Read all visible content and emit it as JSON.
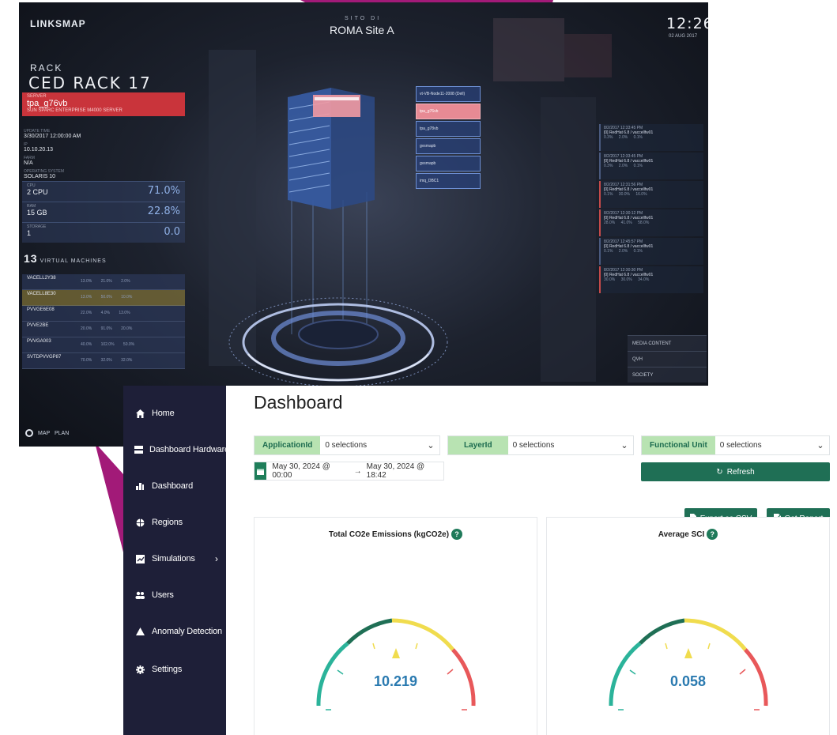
{
  "linksmap": {
    "logo": "LINKSMAP",
    "site_label": "SITO DI",
    "site_name": "ROMA Site A",
    "clock": "12:26",
    "date": "02 AUG 2017",
    "rack_label": "RACK",
    "rack_name": "CED RACK 17",
    "server": {
      "label": "SERVER",
      "name": "tpa_g76vb",
      "subtitle": "SUN SPARC ENTERPRISE M4000 SERVER"
    },
    "info": [
      {
        "key": "UPDATE TIME",
        "value": "3/30/2017 12:00:00 AM"
      },
      {
        "key": "IP",
        "value": "10.10.20.13"
      },
      {
        "key": "FARM",
        "value": "N/A"
      },
      {
        "key": "OPERATING SYSTEM",
        "value": "SOLARIS 10"
      }
    ],
    "metrics": [
      {
        "key": "CPU",
        "value": "2 CPU",
        "percent": "71.0%"
      },
      {
        "key": "RAM",
        "value": "15 GB",
        "percent": "22.8%"
      },
      {
        "key": "STORAGE",
        "value": "1",
        "percent": "0.0"
      }
    ],
    "vm_count": "13",
    "vm_title": "VIRTUAL MACHINES",
    "vms": [
      {
        "name": "VACELL2Y38",
        "metrics": "13.0% 21.0% 2.0%"
      },
      {
        "name": "VACELL8E30",
        "metrics": "13.0% 50.0% 10.0%"
      },
      {
        "name": "PVVGE6E08",
        "metrics": "22.0% 4.0% 13.0%"
      },
      {
        "name": "PVVE2BE",
        "metrics": "20.0% 91.0% 20.0%"
      },
      {
        "name": "PVVGA003",
        "metrics": "40.0% 102.0% 50.0%"
      },
      {
        "name": "SVTDPVVGP87",
        "metrics": "70.0% 32.0% 32.0%"
      }
    ],
    "rack_labels": [
      "vt-VB-Node11-2008 (Dell)",
      "tpa_g76vb",
      "tpa_g78vb",
      "gvsmapb",
      "gvsmapb",
      "imq_DBC1"
    ],
    "logs": [
      {
        "time": "8/2/2017 12:33:45 PM",
        "desc": "[0] RedHat 6.8 / vaccellfw01",
        "metrics": "0.3% 2.0% 0.1%",
        "red": false
      },
      {
        "time": "8/2/2017 12:33:45 PM",
        "desc": "[0] RedHat 6.8 / vaccellfw01",
        "metrics": "0.3% 2.0% 0.1%",
        "red": false
      },
      {
        "time": "8/2/2017 12:31:56 PM",
        "desc": "[0] RedHat 6.8 / vaccellfw01",
        "metrics": "0.1% 30.0% 16.0%",
        "red": true
      },
      {
        "time": "8/2/2017 12:30:12 PM",
        "desc": "[0] RedHat 6.8 / vaccellfw01",
        "metrics": "28.0% 41.0% 58.0%",
        "red": true
      },
      {
        "time": "8/2/2017 12:45:57 PM",
        "desc": "[0] RedHat 6.8 / vaccellfw01",
        "metrics": "0.1% 2.0% 0.1%",
        "red": false
      },
      {
        "time": "8/2/2017 12:30:30 PM",
        "desc": "[0] RedHat 6.8 / vaccellfw01",
        "metrics": "30.0% 30.0% 34.0%",
        "red": true
      }
    ],
    "media": [
      "MEDIA CONTENT",
      "QVH",
      "SOCIETY"
    ],
    "nav": "MAP  PLAN"
  },
  "sidebar": {
    "items": [
      {
        "label": "Home",
        "icon": "home-icon"
      },
      {
        "label": "Dashboard Hardware",
        "icon": "server-icon"
      },
      {
        "label": "Dashboard",
        "icon": "bar-chart-icon"
      },
      {
        "label": "Regions",
        "icon": "globe-icon"
      },
      {
        "label": "Simulations",
        "icon": "chart-icon"
      },
      {
        "label": "Users",
        "icon": "users-icon"
      },
      {
        "label": "Anomaly Detection",
        "icon": "warning-icon"
      },
      {
        "label": "Settings",
        "icon": "gear-icon"
      }
    ],
    "chevron": "›"
  },
  "dashboard": {
    "title": "Dashboard",
    "filters": [
      {
        "label": "ApplicationId",
        "value": "0 selections"
      },
      {
        "label": "LayerId",
        "value": "0 selections"
      },
      {
        "label": "Functional Unit",
        "value": "0 selections"
      }
    ],
    "date_from": "May 30, 2024 @ 00:00",
    "arrow": "→",
    "date_to": "May 30, 2024 @ 18:42",
    "refresh": "Refresh",
    "export_csv": "Export as CSV",
    "get_report": "Get Report",
    "cards": [
      {
        "title": "Total CO2e Emissions (kgCO2e)",
        "value": "10.219",
        "help": "?"
      },
      {
        "title": "Average SCI",
        "value": "0.058",
        "help": "?"
      }
    ]
  },
  "colors": {
    "sidebar_bg": "#1e1f38",
    "accent_green": "#1f6f55",
    "filter_label_bg": "#b8e3b2",
    "gauge_teal": "#2bb39a",
    "gauge_yellow": "#f0dc4e",
    "gauge_red": "#e8585a",
    "gauge_value": "#2a7ab0",
    "deco_purple": "#a21a78"
  }
}
